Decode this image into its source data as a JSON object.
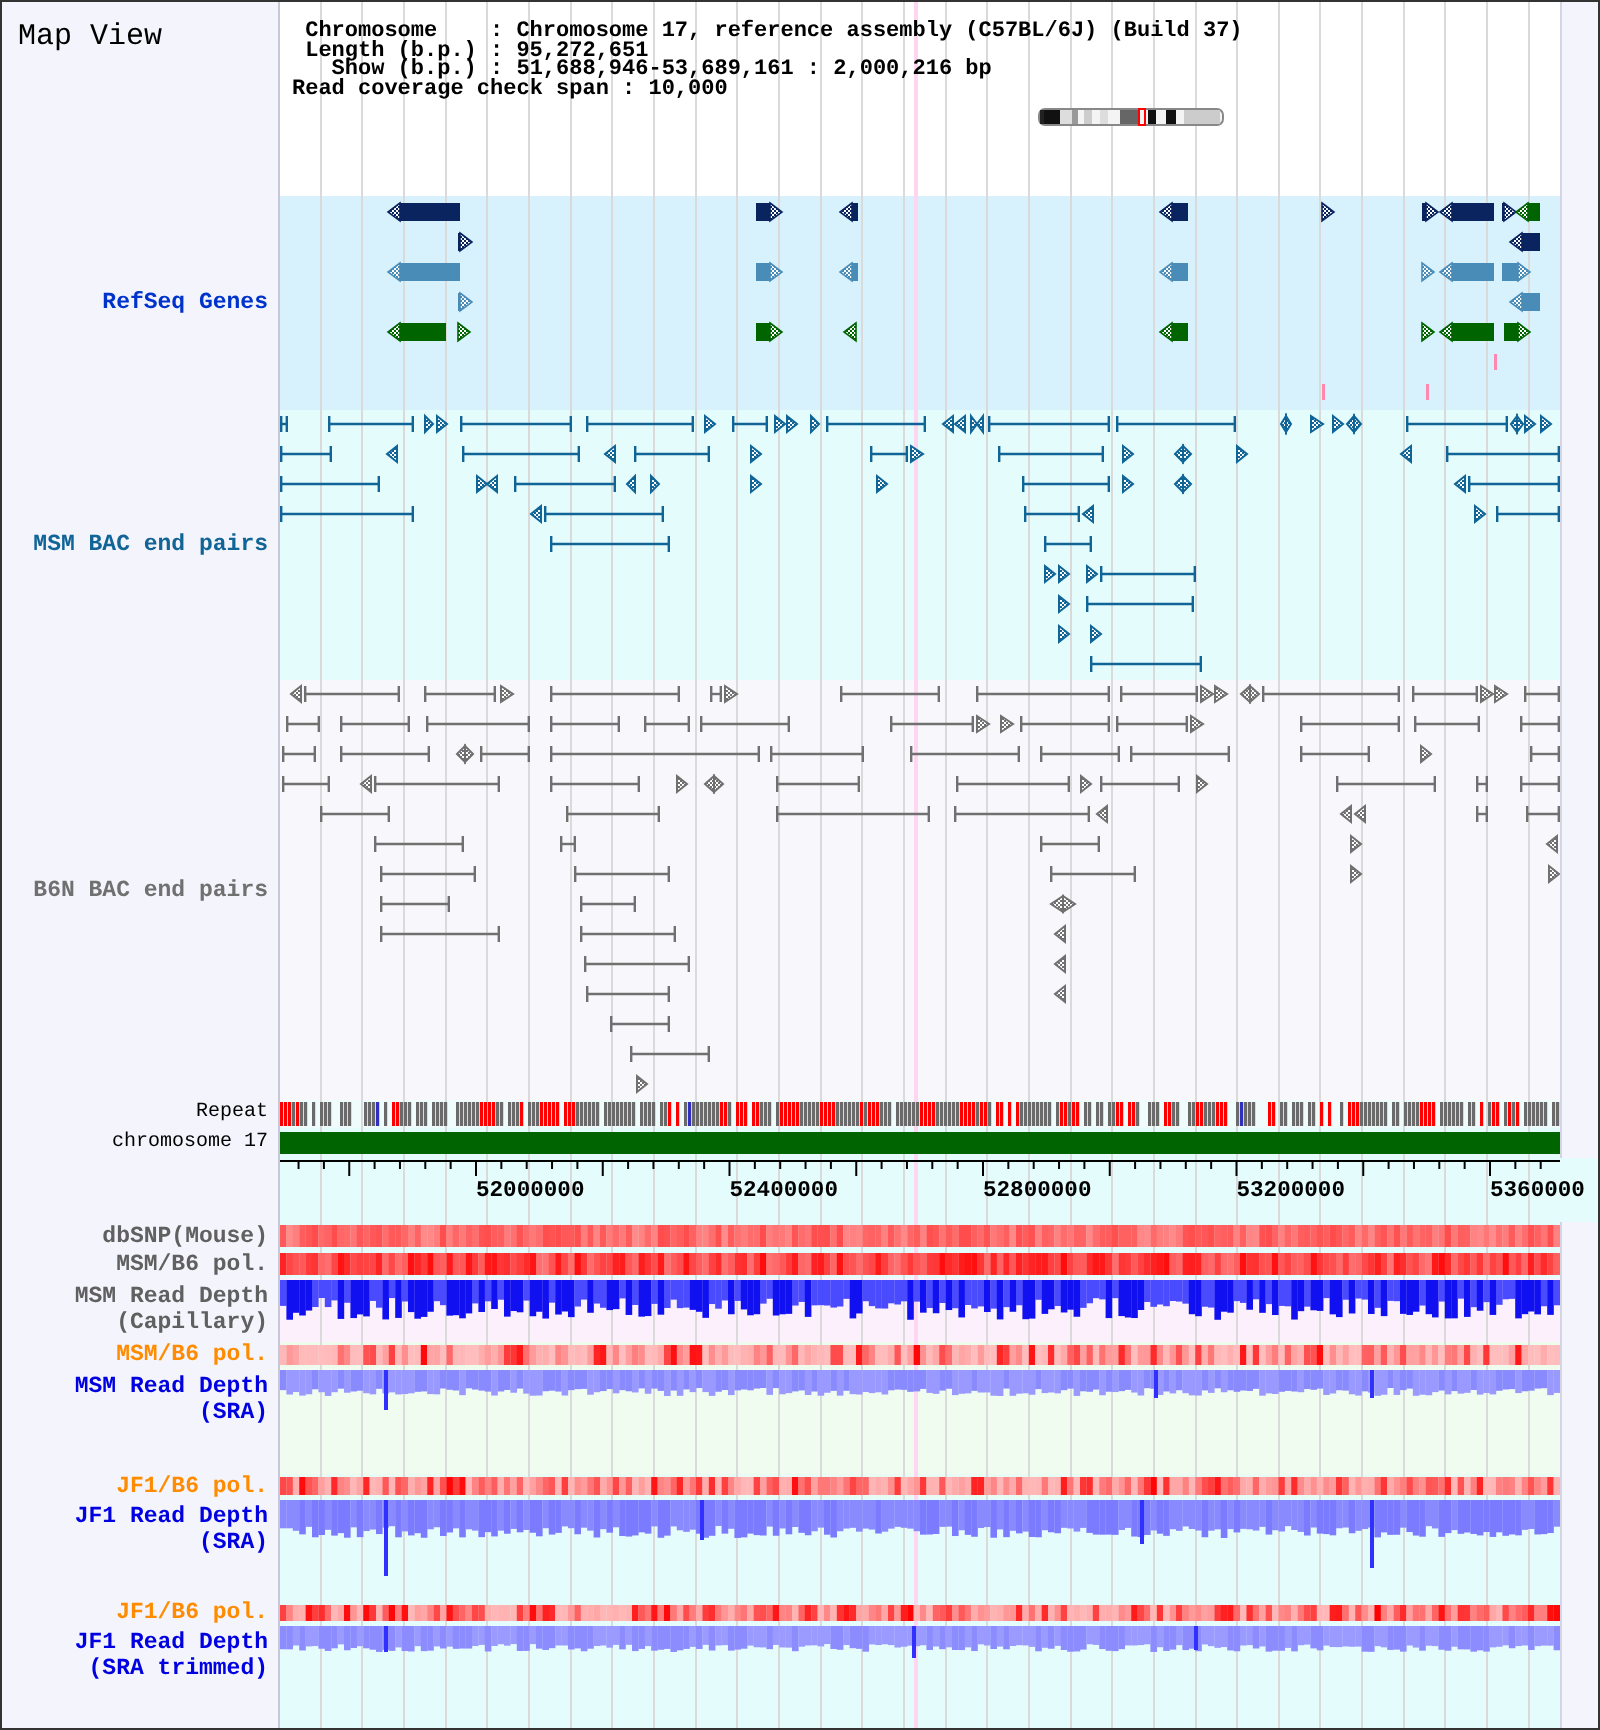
{
  "title": "Map View",
  "info": [
    "Chromosome    : Chromosome 17, reference assembly (C57BL/6J) (Build 37)",
    "Length (b.p.) : 95,272,651",
    "Show (b.p.) : 51,688,946-53,689,161 : 2,000,216 bp",
    "Read coverage check span : 10,000"
  ],
  "tracks": [
    {
      "kind": "genes",
      "label": "RefSeq Genes",
      "color": "#0033cc"
    },
    {
      "kind": "bac_pairs",
      "label": "MSM BAC end pairs",
      "color": "#106496"
    },
    {
      "kind": "bac_pairs",
      "label": "B6N BAC end pairs",
      "color": "#707070"
    },
    {
      "kind": "repeat",
      "label": "Repeat"
    },
    {
      "kind": "chromosome",
      "label": "chromosome 17"
    },
    {
      "kind": "axis",
      "labels": [
        "52000000",
        "52400000",
        "52800000",
        "53200000",
        "5360000"
      ]
    },
    {
      "kind": "heatmap",
      "label": "dbSNP(Mouse)",
      "color": "#606060"
    },
    {
      "kind": "heatmap",
      "label": "MSM/B6 pol.",
      "color": "#606060"
    },
    {
      "kind": "depth",
      "label": "MSM Read Depth (Capillary)",
      "color": "#606060"
    },
    {
      "kind": "heatmap",
      "label": "MSM/B6 pol.",
      "color": "#ff8c00"
    },
    {
      "kind": "depth",
      "label": "MSM Read Depth (SRA)",
      "color": "#0000e0"
    },
    {
      "kind": "heatmap",
      "label": "JF1/B6 pol.",
      "color": "#ff8c00"
    },
    {
      "kind": "depth",
      "label": "JF1 Read Depth (SRA)",
      "color": "#0000e0"
    },
    {
      "kind": "heatmap",
      "label": "JF1/B6 pol.",
      "color": "#ff8c00"
    },
    {
      "kind": "depth",
      "label": "JF1 Read Depth (SRA trimmed)",
      "color": "#0000e0"
    }
  ]
}
